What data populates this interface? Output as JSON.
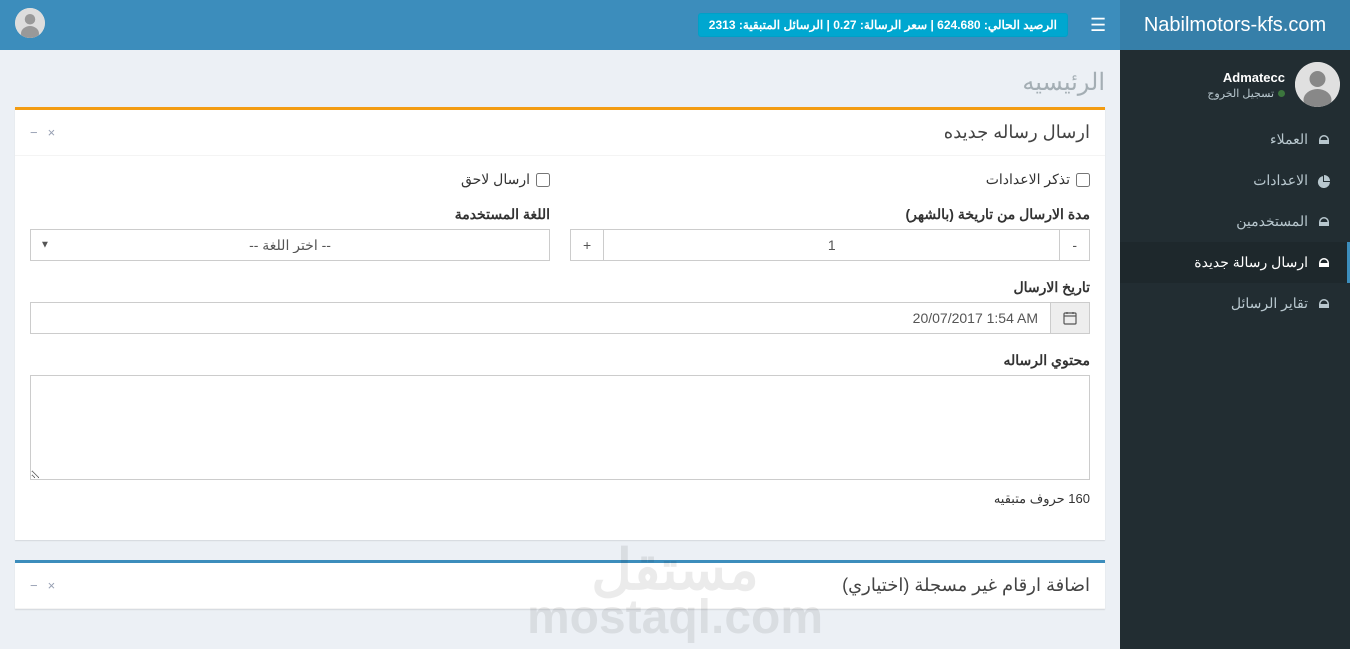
{
  "brand": "Nabilmotors-kfs.com",
  "balance_text": "الرصيد الحالي: 624.680 | سعر الرسالة: 0.27 | الرسائل المتبقية: 2313",
  "user": {
    "name": "Admatecc",
    "logout": "تسجيل الخروج"
  },
  "sidebar": {
    "items": [
      {
        "label": "العملاء",
        "icon": "dashboard"
      },
      {
        "label": "الاعدادات",
        "icon": "pie"
      },
      {
        "label": "المستخدمين",
        "icon": "dashboard"
      },
      {
        "label": "ارسال رسالة جديدة",
        "icon": "dashboard"
      },
      {
        "label": "تقاير الرسائل",
        "icon": "dashboard"
      }
    ]
  },
  "page": {
    "title": "الرئيسيه"
  },
  "panel1": {
    "title": "ارسال رساله جديده",
    "remember_settings": "تذكر الاعدادات",
    "send_later": "ارسال لاحق",
    "duration_label": "مدة الارسال من تاريخة (بالشهر)",
    "duration_value": "1",
    "language_label": "اللغة المستخدمة",
    "language_placeholder": "-- اختر اللغة --",
    "send_date_label": "تاريخ الارسال",
    "send_date_value": "20/07/2017 1:54 AM",
    "content_label": "محتوي الرساله",
    "content_value": "",
    "chars_remaining": "160 حروف متبقيه"
  },
  "panel2": {
    "title": "اضافة ارقام غير مسجلة (اختياري)"
  },
  "watermark": {
    "ar": "مستقل",
    "en": "mostaql.com"
  }
}
